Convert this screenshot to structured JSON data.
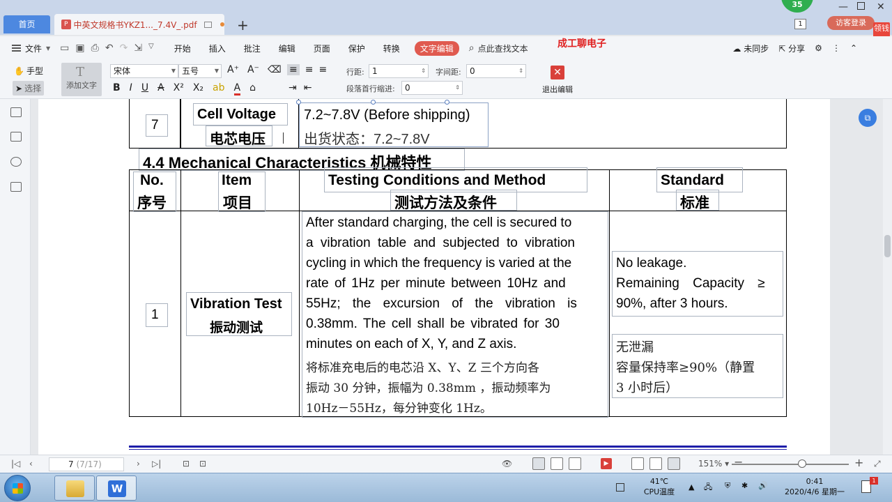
{
  "tabs": {
    "home": "首页",
    "document": "中英文规格书YKZ1..._7.4V_.pdf",
    "badge_count": "35",
    "page_badge": "1",
    "visitor_login": "访客登录",
    "side_tag": "领钱"
  },
  "menubar": {
    "file": "文件",
    "items": [
      "开始",
      "插入",
      "批注",
      "编辑",
      "页面",
      "保护",
      "转换"
    ],
    "active": "文字编辑",
    "search": "点此查找文本",
    "brand": "成工聊电子",
    "sync": "未同步",
    "share": "分享"
  },
  "ribbon": {
    "hand": "手型",
    "select": "选择",
    "add_text": "添加文字",
    "font_name": "宋体",
    "font_size": "五号",
    "line_spacing_label": "行距:",
    "line_spacing": "1",
    "char_spacing_label": "字间距:",
    "char_spacing": "0",
    "indent_label": "段落首行缩进:",
    "indent": "0",
    "exit_edit": "退出编辑"
  },
  "document": {
    "row7": {
      "no": "7",
      "item_en": "Cell Voltage",
      "item_cn": "电芯电压",
      "value_en": "7.2~7.8V (Before shipping)",
      "value_cn": "出货状态：7.2~7.8V"
    },
    "section_title": "4.4 Mechanical Characteristics 机械特性",
    "headers": {
      "no_en": "No.",
      "no_cn": "序号",
      "item_en": "Item",
      "item_cn": "项目",
      "test_en": "Testing Conditions and Method",
      "test_cn": "测试方法及条件",
      "std_en": "Standard",
      "std_cn": "标准"
    },
    "row1": {
      "no": "1",
      "item_en": "Vibration Test",
      "item_cn": "振动测试",
      "method_lines": [
        "After standard charging, the cell is secured to",
        "a vibration table and subjected to vibration",
        "cycling in which the frequency is varied at the",
        "rate of 1Hz per minute between 10Hz and",
        "55Hz; the excursion of the vibration is",
        "0.38mm. The cell shall be vibrated for 30",
        "minutes on each of X, Y, and Z axis."
      ],
      "method_cn_lines": [
        "将标准充电后的电芯沿 X、Y、Z 三个方向各",
        "振动 30 分钟，振幅为 0.38mm ，振动频率为",
        "10Hz－55Hz，每分钟变化 1Hz。"
      ],
      "std_en_lines": [
        "No leakage.",
        "Remaining Capacity ≥",
        "90%, after 3 hours."
      ],
      "std_cn_lines": [
        "无泄漏",
        "容量保持率≥90%（静置",
        "3 小时后）"
      ]
    }
  },
  "statusbar": {
    "page_current": "7",
    "page_total": "(7/17)",
    "zoom": "151%"
  },
  "taskbar": {
    "cpu_temp": "41℃",
    "cpu_label": "CPU温度",
    "time": "0:41",
    "date": "2020/4/6 星期一",
    "notif_count": "1"
  }
}
